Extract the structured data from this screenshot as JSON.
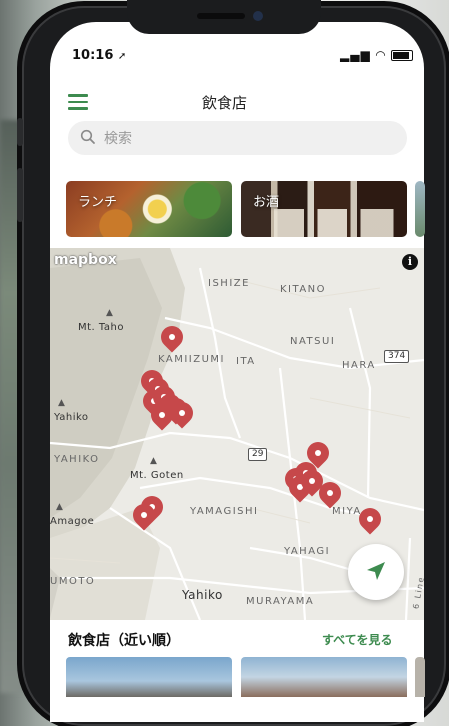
{
  "status_bar": {
    "time": "10:16",
    "time_suffix": "➚"
  },
  "header": {
    "title": "飲食店"
  },
  "search": {
    "placeholder": "検索"
  },
  "categories": [
    {
      "label": "ランチ"
    },
    {
      "label": "お酒"
    }
  ],
  "map": {
    "logo": "mapbox",
    "info_icon": "i",
    "places": {
      "ishize": "ISHIZE",
      "kitano": "KITANO",
      "mt_taho": "Mt. Taho",
      "natsui": "NATSUI",
      "kamiizumi": "KAMIIZUMI",
      "ita": "ITA",
      "hara": "HARA",
      "yahiko_station": "Yahiko",
      "yahiko_area": "YAHIKO",
      "mt_goten": "Mt. Goten",
      "amagoe": "Amagoe",
      "yamagishi": "YAMAGISHI",
      "miya": "MIYA",
      "yahagi": "YAHAGI",
      "umoto": "UMOTO",
      "yahiko_town": "Yahiko",
      "murayama": "MURAYAMA",
      "line": "6 Line"
    },
    "routes": {
      "r374": "374",
      "r29": "29"
    }
  },
  "list": {
    "heading": "飲食店（近い順）",
    "see_all": "すべてを見る"
  },
  "colors": {
    "accent": "#3d8b4f",
    "pin": "#c6484a"
  }
}
